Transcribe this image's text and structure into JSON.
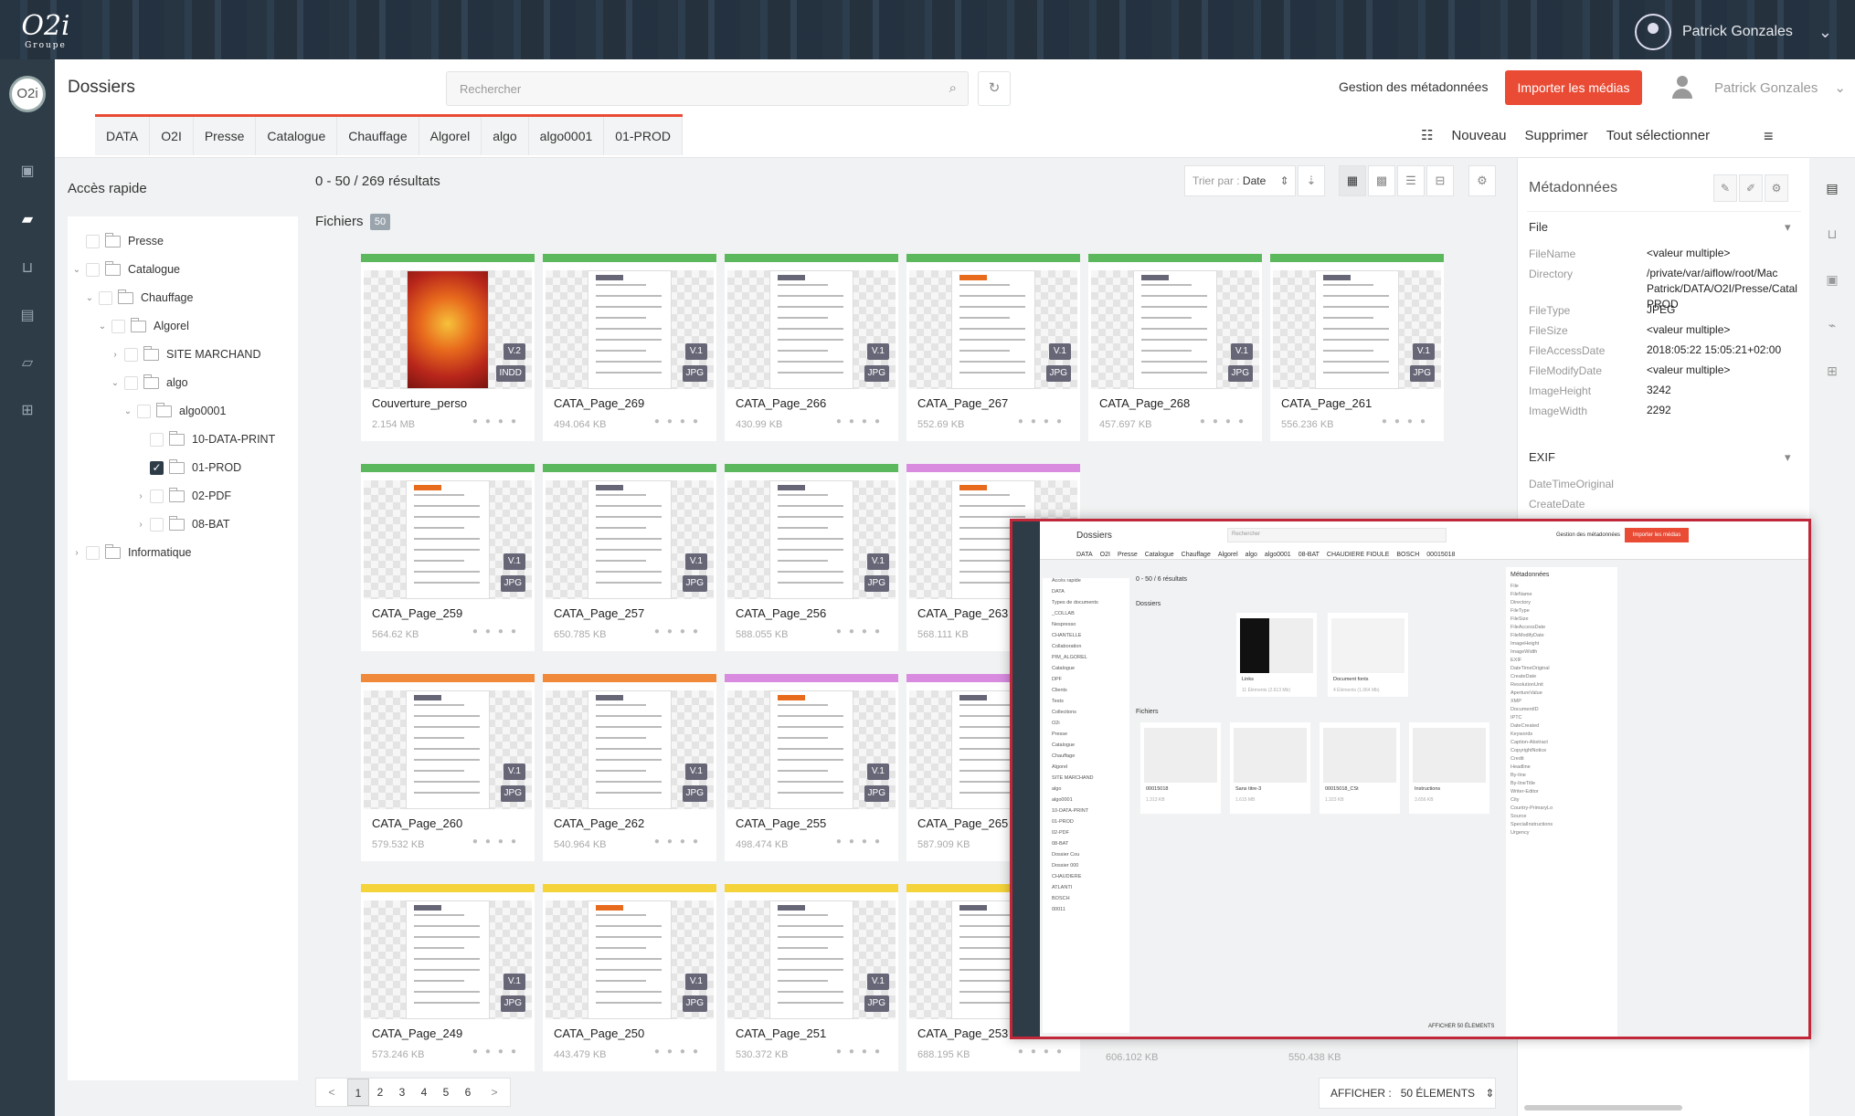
{
  "topbar": {
    "user_name": "Patrick Gonzales",
    "logo_text": "O2i",
    "logo_sub": "Groupe"
  },
  "header": {
    "title": "Dossiers",
    "search_placeholder": "Rechercher",
    "metadata_link": "Gestion des métadonnées",
    "import_button": "Importer les médias",
    "user_name": "Patrick Gonzales"
  },
  "breadcrumb_tabs": [
    "DATA",
    "O2I",
    "Presse",
    "Catalogue",
    "Chauffage",
    "Algorel",
    "algo",
    "algo0001",
    "01-PROD"
  ],
  "actions": {
    "new": "Nouveau",
    "delete": "Supprimer",
    "select_all": "Tout sélectionner"
  },
  "quick_access": {
    "title": "Accès rapide",
    "tree": [
      {
        "label": "Presse",
        "checked": false
      },
      {
        "label": "Catalogue",
        "checked": false
      },
      {
        "label": "Chauffage",
        "checked": false
      },
      {
        "label": "Algorel",
        "checked": false
      },
      {
        "label": "SITE MARCHAND",
        "checked": false
      },
      {
        "label": "algo",
        "checked": false
      },
      {
        "label": "algo0001",
        "checked": false
      },
      {
        "label": "10-DATA-PRINT",
        "checked": false
      },
      {
        "label": "01-PROD",
        "checked": true
      },
      {
        "label": "02-PDF",
        "checked": false
      },
      {
        "label": "08-BAT",
        "checked": false
      },
      {
        "label": "Informatique",
        "checked": false
      }
    ]
  },
  "results": {
    "summary": "0 - 50 / 269 résultats",
    "sort_label": "Trier par :",
    "sort_value": "Date",
    "files_label": "Fichiers",
    "files_count": "50"
  },
  "files": [
    {
      "name": "Couverture_perso",
      "size": "2.154 MB",
      "version": "V.2",
      "type": "INDD",
      "color": "#5cb85c"
    },
    {
      "name": "CATA_Page_269",
      "size": "494.064 KB",
      "version": "V.1",
      "type": "JPG",
      "color": "#5cb85c"
    },
    {
      "name": "CATA_Page_266",
      "size": "430.99 KB",
      "version": "V.1",
      "type": "JPG",
      "color": "#5cb85c"
    },
    {
      "name": "CATA_Page_267",
      "size": "552.69 KB",
      "version": "V.1",
      "type": "JPG",
      "color": "#5cb85c"
    },
    {
      "name": "CATA_Page_268",
      "size": "457.697 KB",
      "version": "V.1",
      "type": "JPG",
      "color": "#5cb85c"
    },
    {
      "name": "CATA_Page_261",
      "size": "556.236 KB",
      "version": "V.1",
      "type": "JPG",
      "color": "#5cb85c"
    },
    {
      "name": "CATA_Page_259",
      "size": "564.62 KB",
      "version": "V.1",
      "type": "JPG",
      "color": "#5cb85c"
    },
    {
      "name": "CATA_Page_257",
      "size": "650.785 KB",
      "version": "V.1",
      "type": "JPG",
      "color": "#5cb85c"
    },
    {
      "name": "CATA_Page_256",
      "size": "588.055 KB",
      "version": "V.1",
      "type": "JPG",
      "color": "#5cb85c"
    },
    {
      "name": "CATA_Page_263",
      "size": "568.111 KB",
      "version": "V.1",
      "type": "JPG",
      "color": "#d98be0"
    },
    {
      "name": "CATA_Page_260",
      "size": "579.532 KB",
      "version": "V.1",
      "type": "JPG",
      "color": "#f0893a"
    },
    {
      "name": "CATA_Page_262",
      "size": "540.964 KB",
      "version": "V.1",
      "type": "JPG",
      "color": "#f0893a"
    },
    {
      "name": "CATA_Page_255",
      "size": "498.474 KB",
      "version": "V.1",
      "type": "JPG",
      "color": "#d98be0"
    },
    {
      "name": "CATA_Page_265",
      "size": "587.909 KB",
      "version": "V.1",
      "type": "JPG",
      "color": "#d98be0"
    },
    {
      "name": "CATA_Page_249",
      "size": "573.246 KB",
      "version": "V.1",
      "type": "JPG",
      "color": "#f5d33a"
    },
    {
      "name": "CATA_Page_250",
      "size": "443.479 KB",
      "version": "V.1",
      "type": "JPG",
      "color": "#f5d33a"
    },
    {
      "name": "CATA_Page_251",
      "size": "530.372 KB",
      "version": "V.1",
      "type": "JPG",
      "color": "#f5d33a"
    },
    {
      "name": "CATA_Page_253",
      "size": "688.195 KB",
      "version": "V.1",
      "type": "JPG",
      "color": "#f5d33a"
    }
  ],
  "hidden_sizes": {
    "col5": "606.102 KB",
    "col6": "550.438 KB"
  },
  "pagination": {
    "pages": [
      "1",
      "2",
      "3",
      "4",
      "5",
      "6"
    ],
    "prev": "<",
    "next": ">",
    "show_label": "AFFICHER :",
    "show_value": "50 ÉLEMENTS"
  },
  "metadata": {
    "title": "Métadonnées",
    "section_file": "File",
    "section_exif": "EXIF",
    "rows": [
      {
        "k": "FileName",
        "v": "<valeur multiple>"
      },
      {
        "k": "Directory",
        "v": "/private/var/aiflow/root/Mac Patrick/DATA/O2I/Presse/Catal PROD"
      },
      {
        "k": "FileType",
        "v": "JPEG"
      },
      {
        "k": "FileSize",
        "v": "<valeur multiple>"
      },
      {
        "k": "FileAccessDate",
        "v": "2018:05:22 15:05:21+02:00"
      },
      {
        "k": "FileModifyDate",
        "v": "<valeur multiple>"
      },
      {
        "k": "ImageHeight",
        "v": "3242"
      },
      {
        "k": "ImageWidth",
        "v": "2292"
      }
    ],
    "exif_rows": [
      "DateTimeOriginal",
      "CreateDate"
    ]
  },
  "inset": {
    "title": "Dossiers",
    "search": "Rechercher",
    "meta_link": "Gestion des métadonnées",
    "import": "Importer les médias",
    "tabs": [
      "DATA",
      "O2I",
      "Presse",
      "Catalogue",
      "Chauffage",
      "Algorel",
      "algo",
      "algo0001",
      "08-BAT",
      "CHAUDIERE FIOULE",
      "BOSCH",
      "00015018"
    ],
    "summary": "0 - 50 / 6 résultats",
    "folders_label": "Dossiers",
    "files_label": "Fichiers",
    "folders": [
      {
        "name": "Links",
        "sub": "11 Éléments (2.613 Mb)"
      },
      {
        "name": "Document fonts",
        "sub": "4 Éléments (1.064 Mb)"
      }
    ],
    "files": [
      {
        "name": "00015018",
        "size": "1.313 KB"
      },
      {
        "name": "Sans titre-3",
        "size": "1.615 MB"
      },
      {
        "name": "00015018_CSt",
        "size": "1.323 KB"
      },
      {
        "name": "Instructions",
        "size": "3.656 KB"
      }
    ],
    "tree": [
      "DATA",
      "Types de documents",
      "_COLLAB",
      "Nespresso",
      "CHANTELLE",
      "Collaboration",
      "PIM_ALGOREL",
      "Catalogue",
      "DPF",
      "Clients",
      "Tests",
      "Collections",
      "O2i",
      "Presse",
      "Catalogue",
      "Chauffage",
      "Algorel",
      "SITE MARCHAND",
      "algo",
      "algo0001",
      "10-DATA-PRINT",
      "01-PROD",
      "02-PDF",
      "08-BAT",
      "Dossier Cou",
      "Dossier 000",
      "CHAUDIERE",
      "ATLANTI",
      "BOSCH",
      "00011"
    ],
    "meta_title": "Métadonnées",
    "meta_rows": [
      "File",
      "FileName",
      "Directory",
      "FileType",
      "FileSize",
      "FileAccessDate",
      "FileModifyDate",
      "ImageHeight",
      "ImageWidth",
      "EXIF",
      "DateTimeOriginal",
      "CreateDate",
      "ResolutionUnit",
      "ApertureValue",
      "XMP",
      "DocumentID",
      "IPTC",
      "DateCreated",
      "Keywords",
      "Caption-Abstract",
      "CopyrightNotice",
      "Credit",
      "Headline",
      "By-line",
      "By-lineTitle",
      "Writer-Editor",
      "City",
      "Country-PrimaryLo",
      "Source",
      "SpecialInstructions",
      "Urgency"
    ],
    "show": "AFFICHER",
    "show_val": "50 ÉLEMENTS"
  }
}
